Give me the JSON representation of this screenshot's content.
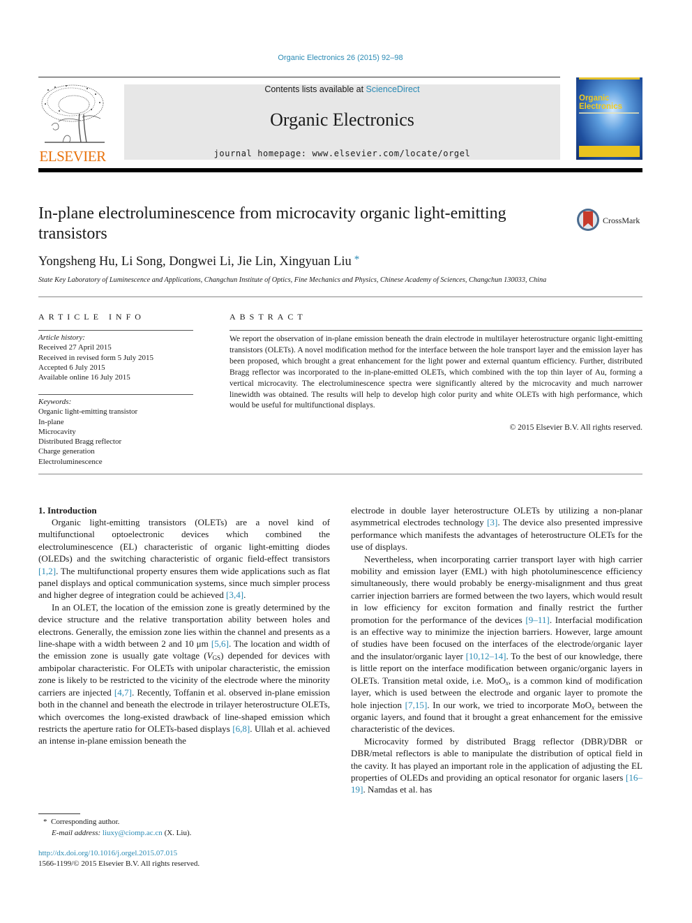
{
  "header": {
    "journal_ref": "Organic Electronics 26 (2015) 92–98",
    "contents_prefix": "Contents lists available at ",
    "contents_link": "ScienceDirect",
    "journal_name": "Organic Electronics",
    "homepage": "journal homepage: www.elsevier.com/locate/orgel",
    "publisher_logo_text": "ELSEVIER",
    "cover_title_line1": "Organic",
    "cover_title_line2": "Electronics",
    "accent_color": "#2a8ab4",
    "publisher_color": "#e8720c"
  },
  "article": {
    "title": "In-plane electroluminescence from microcavity organic light-emitting transistors",
    "crossmark_label": "CrossMark",
    "authors": "Yongsheng Hu, Li Song, Dongwei Li, Jie Lin, Xingyuan Liu",
    "corresponding_marker": "*",
    "affiliation": "State Key Laboratory of Luminescence and Applications, Changchun Institute of Optics, Fine Mechanics and Physics, Chinese Academy of Sciences, Changchun 130033, China"
  },
  "article_info": {
    "heading": "ARTICLE INFO",
    "history_label": "Article history:",
    "history": [
      "Received 27 April 2015",
      "Received in revised form 5 July 2015",
      "Accepted 6 July 2015",
      "Available online 16 July 2015"
    ],
    "keywords_label": "Keywords:",
    "keywords": [
      "Organic light-emitting transistor",
      "In-plane",
      "Microcavity",
      "Distributed Bragg reflector",
      "Charge generation",
      "Electroluminescence"
    ]
  },
  "abstract": {
    "heading": "ABSTRACT",
    "text": "We report the observation of in-plane emission beneath the drain electrode in multilayer heterostructure organic light-emitting transistors (OLETs). A novel modification method for the interface between the hole transport layer and the emission layer has been proposed, which brought a great enhancement for the light power and external quantum efficiency. Further, distributed Bragg reflector was incorporated to the in-plane-emitted OLETs, which combined with the top thin layer of Au, forming a vertical microcavity. The electroluminescence spectra were significantly altered by the microcavity and much narrower linewidth was obtained. The results will help to develop high color purity and white OLETs with high performance, which would be useful for multifunctional displays.",
    "copyright": "© 2015 Elsevier B.V. All rights reserved."
  },
  "body": {
    "section_heading": "1. Introduction",
    "left": {
      "p1": [
        "Organic light-emitting transistors (OLETs) are a novel kind of multifunctional optoelectronic devices which combined the electroluminescence (EL) characteristic of organic light-emitting diodes (OLEDs) and the switching characteristic of organic field-effect transistors ",
        "[1,2]",
        ". The multifunctional property ensures them wide applications such as flat panel displays and optical communication systems, since much simpler process and higher degree of integration could be achieved ",
        "[3,4]",
        "."
      ],
      "p2a": "In an OLET, the location of the emission zone is greatly determined by the device structure and the relative transportation ability between holes and electrons. Generally, the emission zone lies within the channel and presents as a line-shape with a width between 2 and 10 μm ",
      "ref_56": "[5,6]",
      "p2b": ". The location and width of the emission zone is usually gate voltage (",
      "vgs_v": "V",
      "vgs_sub": "GS",
      "p2c": ") depended for devices with ambipolar characteristic. For OLETs with unipolar characteristic, the emission zone is likely to be restricted to the vicinity of the electrode where the minority carriers are injected ",
      "ref_47": "[4,7]",
      "p2d": ". Recently, Toffanin et al. observed in-plane emission both in the channel and beneath the electrode in trilayer heterostructure OLETs, which overcomes the long-existed drawback of line-shaped emission which restricts the aperture ratio for OLETs-based displays ",
      "ref_68": "[6,8]",
      "p2e": ". Ullah et al. achieved an intense in-plane emission beneath the"
    },
    "right": {
      "p1a": "electrode in double layer heterostructure OLETs by utilizing a non-planar asymmetrical electrodes technology ",
      "ref_3": "[3]",
      "p1b": ". The device also presented impressive performance which manifests the advantages of heterostructure OLETs for the use of displays.",
      "p2a": "Nevertheless, when incorporating carrier transport layer with high carrier mobility and emission layer (EML) with high photoluminescence efficiency simultaneously, there would probably be energy-misalignment and thus great carrier injection barriers are formed between the two layers, which would result in low efficiency for exciton formation and finally restrict the further promotion for the performance of the devices ",
      "ref_911": "[9–11]",
      "p2b": ". Interfacial modification is an effective way to minimize the injection barriers. However, large amount of studies have been focused on the interfaces of the electrode/organic layer and the insulator/organic layer ",
      "ref_1014": "[10,12–14]",
      "p2c": ". To the best of our knowledge, there is little report on the interface modification between organic/organic layers in OLETs. Transition metal oxide, i.e. MoO",
      "sub_x": "x",
      "p2d": ", is a common kind of modification layer, which is used between the electrode and organic layer to promote the hole injection ",
      "ref_715": "[7,15]",
      "p2e": ". In our work, we tried to incorporate MoO",
      "p2f": " between the organic layers, and found that it brought a great enhancement for the emissive characteristic of the devices.",
      "p3a": "Microcavity formed by distributed Bragg reflector (DBR)/DBR or DBR/metal reflectors is able to manipulate the distribution of optical field in the cavity. It has played an important role in the application of adjusting the EL properties of OLEDs and providing an optical resonator for organic lasers ",
      "ref_1619": "[16–19]",
      "p3b": ". Namdas et al. has"
    }
  },
  "footnote": {
    "marker": "*",
    "corresponding": "Corresponding author.",
    "email_label": "E-mail address:",
    "email": "liuxy@ciomp.ac.cn",
    "email_suffix": "(X. Liu).",
    "doi": "http://dx.doi.org/10.1016/j.orgel.2015.07.015",
    "issn_line": "1566-1199/© 2015 Elsevier B.V. All rights reserved."
  }
}
